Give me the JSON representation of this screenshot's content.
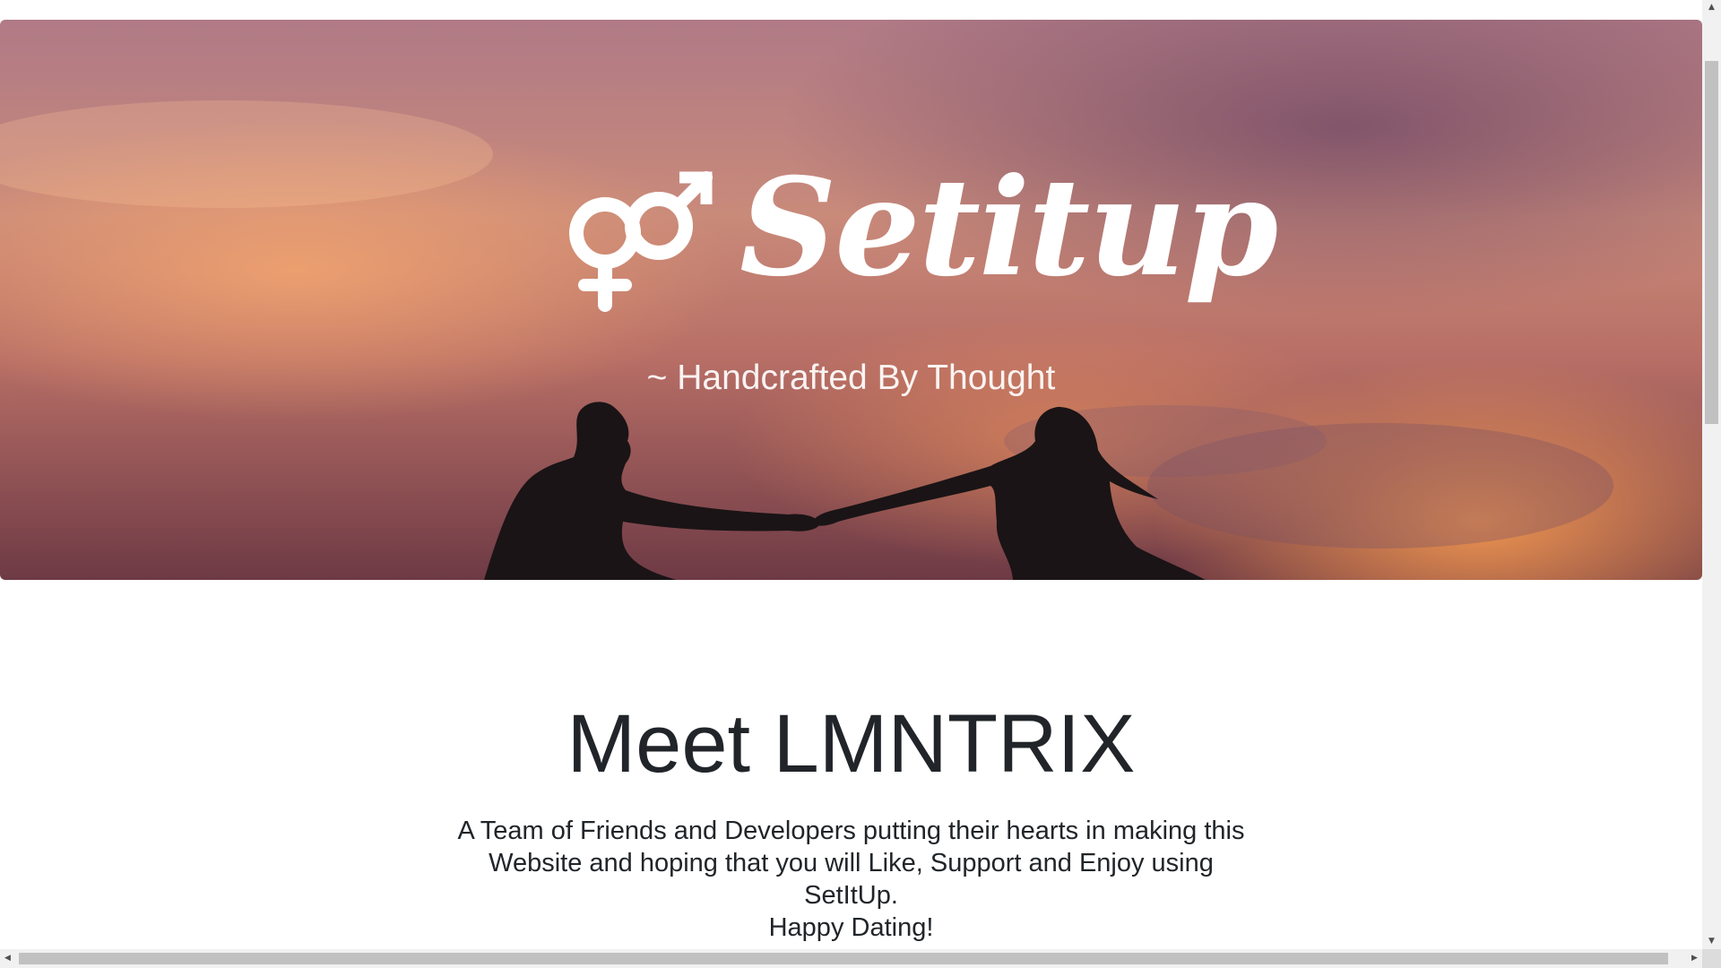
{
  "hero": {
    "brand_name": "Setitup",
    "brand_icon": "gender-symbols-icon",
    "tagline": "~ Handcrafted By Thought",
    "image": "couple-silhouette-sunset"
  },
  "about": {
    "title": "Meet LMNTRIX",
    "lines": [
      "A Team of Friends and Developers putting their hearts in making this",
      "Website and hoping that you will Like, Support and Enjoy using",
      "SetItUp.",
      "Happy Dating!"
    ]
  },
  "scrollbars": {
    "up_arrow": "▲",
    "down_arrow": "▼",
    "left_arrow": "◀",
    "right_arrow": "▶"
  },
  "colors": {
    "text": "#212529",
    "hero_text": "#ffffff",
    "scroll_track": "#f1f1f1",
    "scroll_thumb": "#c1c1c1"
  }
}
